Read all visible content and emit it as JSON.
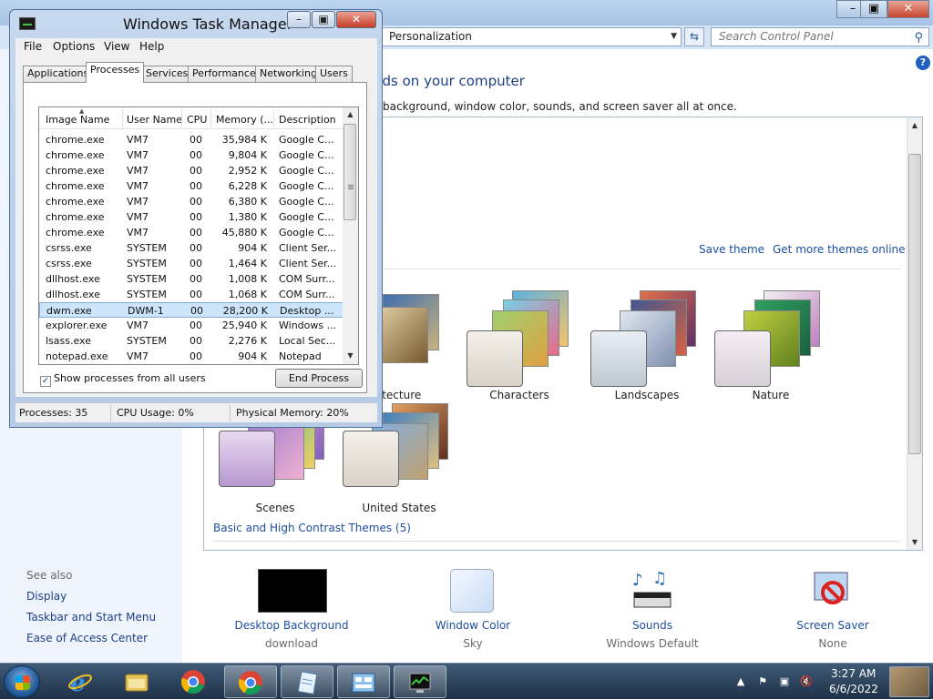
{
  "control_panel": {
    "address": "Personalization",
    "search_placeholder": "Search Control Panel",
    "heading": "nds on your computer",
    "subheading": "background, window color, sounds, and screen saver all at once.",
    "save_theme": "Save theme",
    "more_themes": "Get more themes online",
    "themes": [
      {
        "name": "rchitecture"
      },
      {
        "name": "Characters"
      },
      {
        "name": "Landscapes"
      },
      {
        "name": "Nature"
      },
      {
        "name": "Scenes"
      },
      {
        "name": "United States"
      }
    ],
    "basic_themes": "Basic and High Contrast Themes (5)",
    "see_also": {
      "title": "See also",
      "links": [
        "Display",
        "Taskbar and Start Menu",
        "Ease of Access Center"
      ]
    },
    "bottom_items": [
      {
        "label": "Desktop Background",
        "sub": "download"
      },
      {
        "label": "Window Color",
        "sub": "Sky"
      },
      {
        "label": "Sounds",
        "sub": "Windows Default"
      },
      {
        "label": "Screen Saver",
        "sub": "None"
      }
    ]
  },
  "task_manager": {
    "title": "Windows Task Manager",
    "menu": [
      "File",
      "Options",
      "View",
      "Help"
    ],
    "tabs": [
      "Applications",
      "Processes",
      "Services",
      "Performance",
      "Networking",
      "Users"
    ],
    "active_tab": "Processes",
    "columns": [
      "Image Name",
      "User Name",
      "CPU",
      "Memory (...",
      "Description"
    ],
    "rows": [
      {
        "name": "chrome.exe",
        "user": "VM7",
        "cpu": "00",
        "mem": "35,984 K",
        "desc": "Google C..."
      },
      {
        "name": "chrome.exe",
        "user": "VM7",
        "cpu": "00",
        "mem": "9,804 K",
        "desc": "Google C..."
      },
      {
        "name": "chrome.exe",
        "user": "VM7",
        "cpu": "00",
        "mem": "2,952 K",
        "desc": "Google C..."
      },
      {
        "name": "chrome.exe",
        "user": "VM7",
        "cpu": "00",
        "mem": "6,228 K",
        "desc": "Google C..."
      },
      {
        "name": "chrome.exe",
        "user": "VM7",
        "cpu": "00",
        "mem": "6,380 K",
        "desc": "Google C..."
      },
      {
        "name": "chrome.exe",
        "user": "VM7",
        "cpu": "00",
        "mem": "1,380 K",
        "desc": "Google C..."
      },
      {
        "name": "chrome.exe",
        "user": "VM7",
        "cpu": "00",
        "mem": "45,880 K",
        "desc": "Google C..."
      },
      {
        "name": "csrss.exe",
        "user": "SYSTEM",
        "cpu": "00",
        "mem": "904 K",
        "desc": "Client Ser..."
      },
      {
        "name": "csrss.exe",
        "user": "SYSTEM",
        "cpu": "00",
        "mem": "1,464 K",
        "desc": "Client Ser..."
      },
      {
        "name": "dllhost.exe",
        "user": "SYSTEM",
        "cpu": "00",
        "mem": "1,008 K",
        "desc": "COM Surr..."
      },
      {
        "name": "dllhost.exe",
        "user": "SYSTEM",
        "cpu": "00",
        "mem": "1,068 K",
        "desc": "COM Surr..."
      },
      {
        "name": "dwm.exe",
        "user": "DWM-1",
        "cpu": "00",
        "mem": "28,200 K",
        "desc": "Desktop ...",
        "selected": true
      },
      {
        "name": "explorer.exe",
        "user": "VM7",
        "cpu": "00",
        "mem": "25,940 K",
        "desc": "Windows ..."
      },
      {
        "name": "lsass.exe",
        "user": "SYSTEM",
        "cpu": "00",
        "mem": "2,276 K",
        "desc": "Local Sec..."
      },
      {
        "name": "notepad.exe",
        "user": "VM7",
        "cpu": "00",
        "mem": "904 K",
        "desc": "Notepad"
      }
    ],
    "show_all_label": "Show processes from all users",
    "show_all_checked": true,
    "end_process": "End Process",
    "status": {
      "processes": "Processes: 35",
      "cpu": "CPU Usage: 0%",
      "memory": "Physical Memory: 20%"
    }
  },
  "taskbar": {
    "apps": [
      "internet-explorer",
      "windows-explorer",
      "chrome",
      "chrome",
      "notepad",
      "control-panel",
      "task-manager"
    ],
    "active_app": "task-manager",
    "time": "3:27 AM",
    "date": "6/6/2022"
  }
}
